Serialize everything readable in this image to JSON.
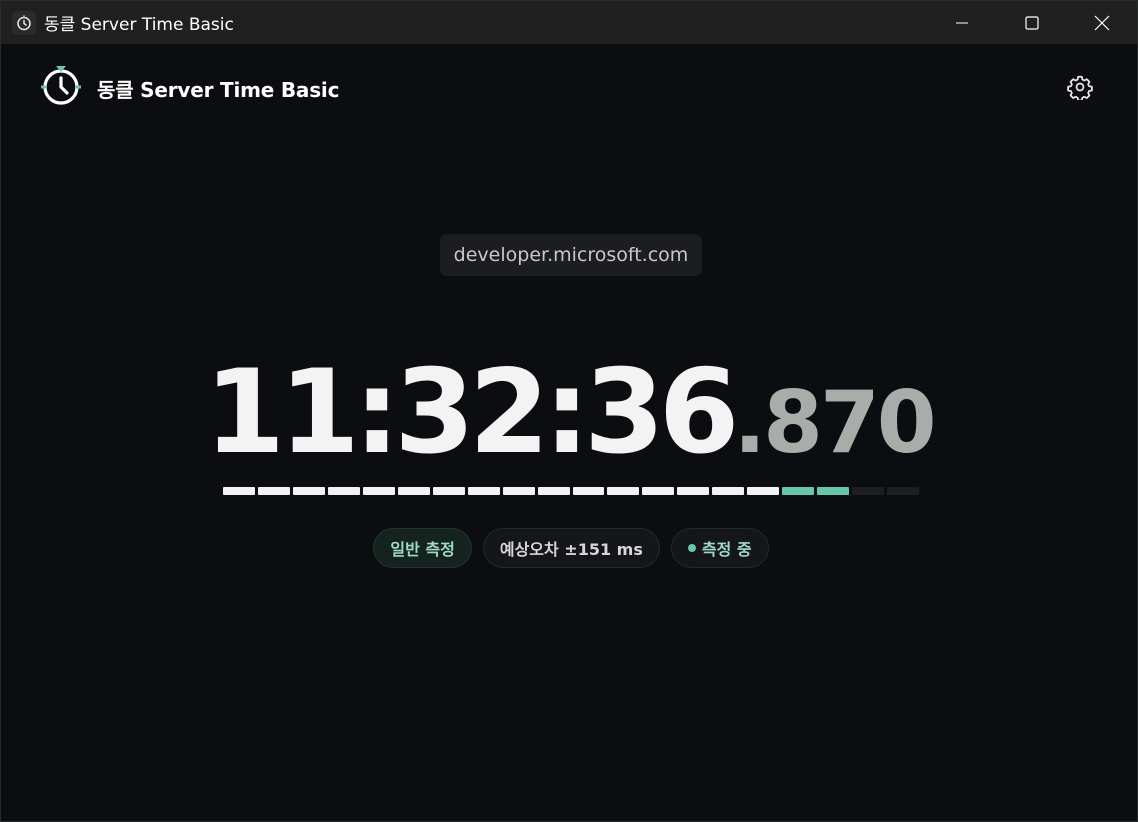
{
  "window": {
    "title": "동클 Server Time Basic",
    "icon": "clock-icon",
    "controls": [
      "minimize-icon",
      "maximize-icon",
      "close-icon"
    ]
  },
  "header": {
    "title": "동클 Server Time Basic",
    "logo": "clock-logo-icon",
    "settings_icon": "gear-icon"
  },
  "server": {
    "url": "developer.microsoft.com"
  },
  "clock": {
    "time": "11:32:36",
    "milliseconds": ".870"
  },
  "progress": {
    "total_segments": 20,
    "filled_segments": 16,
    "accent_segments": 2,
    "colors": {
      "filled": "#f2f2f2",
      "accent": "#68c7a8",
      "empty": "#1d1e22"
    }
  },
  "badges": {
    "mode": "일반 측정",
    "error": "예상오차 ±151 ms",
    "status": "측정 중"
  },
  "colors": {
    "accent": "#68c7a8",
    "background": "#0c0d10",
    "titlebar": "#202020"
  }
}
